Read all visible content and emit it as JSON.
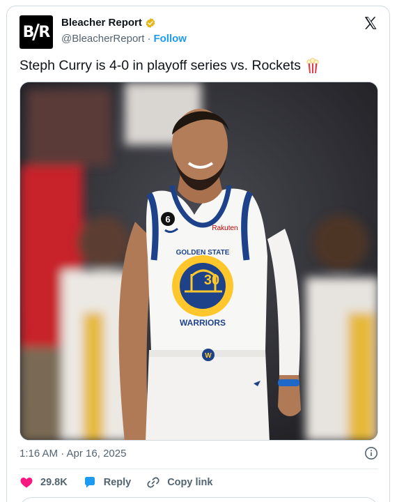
{
  "account": {
    "avatar_text_left": "B",
    "avatar_text_right": "R",
    "display_name": "Bleacher Report",
    "handle": "@BleacherReport",
    "separator": "·",
    "follow_label": "Follow"
  },
  "tweet": {
    "text": "Steph Curry is 4-0 in playoff series vs. Rockets",
    "emoji": "popcorn-icon"
  },
  "media": {
    "jersey_brand": "Rakuten",
    "jersey_team_top": "GOLDEN STATE",
    "jersey_team_bottom": "WARRIORS",
    "jersey_number": "30",
    "patch_number": "6",
    "belt_letter": "W"
  },
  "footer": {
    "timestamp": "1:16 AM · Apr 16, 2025",
    "like_count": "29.8K",
    "reply_label": "Reply",
    "copy_link_label": "Copy link"
  },
  "colors": {
    "brand_blue": "#1d9bf0",
    "like_red": "#f91880",
    "text_secondary": "#536471",
    "warriors_blue": "#1d428a",
    "warriors_gold": "#ffc72c"
  }
}
